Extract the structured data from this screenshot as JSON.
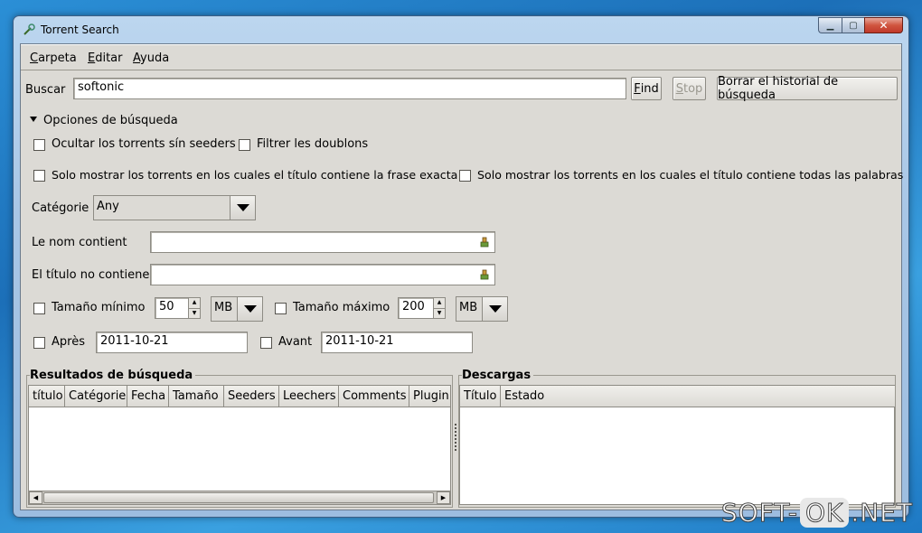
{
  "window": {
    "title": "Torrent Search",
    "buttons": {
      "minimize": "▁",
      "maximize": "▢",
      "close": "✕"
    }
  },
  "menubar": {
    "items": [
      {
        "label": "Carpeta",
        "mnemonic": "C",
        "rest": "arpeta"
      },
      {
        "label": "Editar",
        "mnemonic": "E",
        "rest": "ditar"
      },
      {
        "label": "Ayuda",
        "mnemonic": "A",
        "rest": "yuda"
      }
    ]
  },
  "search": {
    "label": "Buscar",
    "value": "softonic",
    "find_button": {
      "mnemonic": "F",
      "rest": "ind"
    },
    "stop_button": {
      "mnemonic": "S",
      "rest": "top"
    },
    "clear_history_button": "Borrar el historial de búsqueda"
  },
  "options": {
    "expander_label": "Opciones de búsqueda",
    "hide_no_seeders": "Ocultar los torrents sín seeders",
    "filter_duplicates": "Filtrer les doublons",
    "exact_phrase": "Solo mostrar los torrents en los cuales el título contiene la frase exacta",
    "all_words": "Solo mostrar los torrents en los cuales el título contiene todas las palabras",
    "category_label": "Catégorie",
    "category_value": "Any",
    "name_contains_label": "Le nom contient",
    "name_contains_value": "",
    "title_not_contains_label": "El título no contiene",
    "title_not_contains_value": "",
    "min_size_label": "Tamaño mínimo",
    "min_size_value": "50",
    "min_size_unit": "MB",
    "max_size_label": "Tamaño máximo",
    "max_size_value": "200",
    "max_size_unit": "MB",
    "after_label": "Après",
    "after_value": "2011-10-21",
    "before_label": "Avant",
    "before_value": "2011-10-21"
  },
  "results": {
    "title": "Resultados de búsqueda",
    "columns": [
      "título",
      "Catégorie",
      "Fecha",
      "Tamaño",
      "Seeders",
      "Leechers",
      "Comments",
      "Plugin"
    ]
  },
  "downloads": {
    "title": "Descargas",
    "columns": [
      "Título",
      "Estado"
    ]
  },
  "watermark": {
    "left": "SOFT-",
    "middle": "OK",
    "right": ".NET"
  }
}
